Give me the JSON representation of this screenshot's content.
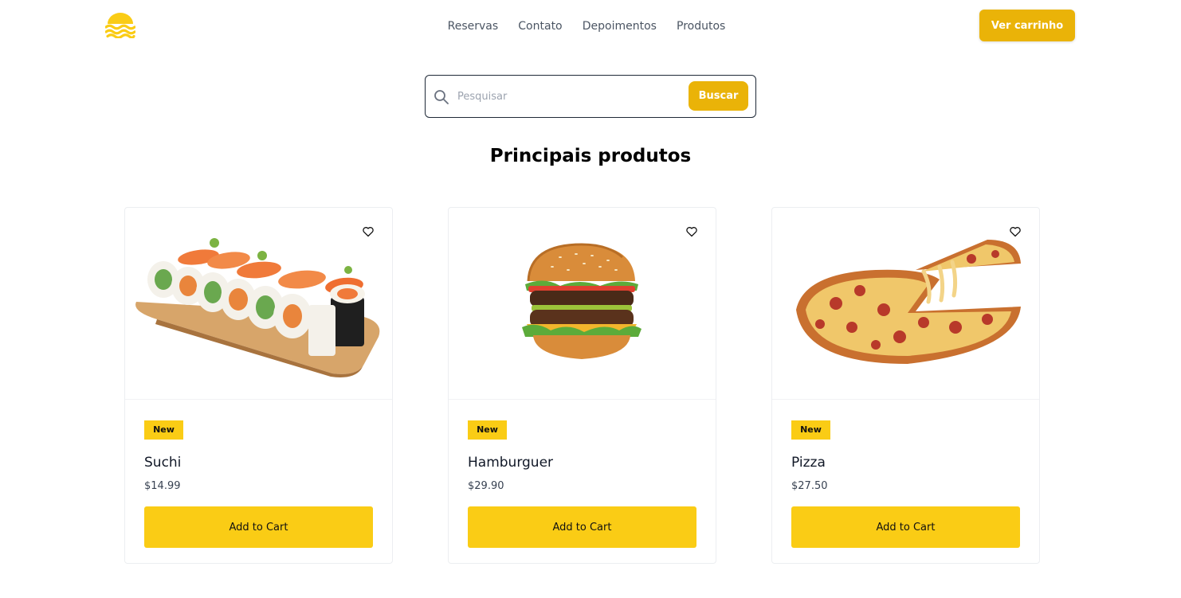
{
  "header": {
    "logo_icon": "waves-sun-logo",
    "nav": [
      "Reservas",
      "Contato",
      "Depoimentos",
      "Produtos"
    ],
    "cart_label": "Ver carrinho"
  },
  "search": {
    "icon": "search-icon",
    "placeholder": "Pesquisar",
    "value": "",
    "button_label": "Buscar"
  },
  "section_title": "Principais produtos",
  "products": [
    {
      "badge": "New",
      "name": "Suchi",
      "price": "$14.99",
      "button": "Add to Cart",
      "image": "sushi-image"
    },
    {
      "badge": "New",
      "name": "Hamburguer",
      "price": "$29.90",
      "button": "Add to Cart",
      "image": "hamburger-image"
    },
    {
      "badge": "New",
      "name": "Pizza",
      "price": "$27.50",
      "button": "Add to Cart",
      "image": "pizza-image"
    }
  ],
  "colors": {
    "brand": "#eab308",
    "badge": "#facc15",
    "button": "#facc15"
  }
}
